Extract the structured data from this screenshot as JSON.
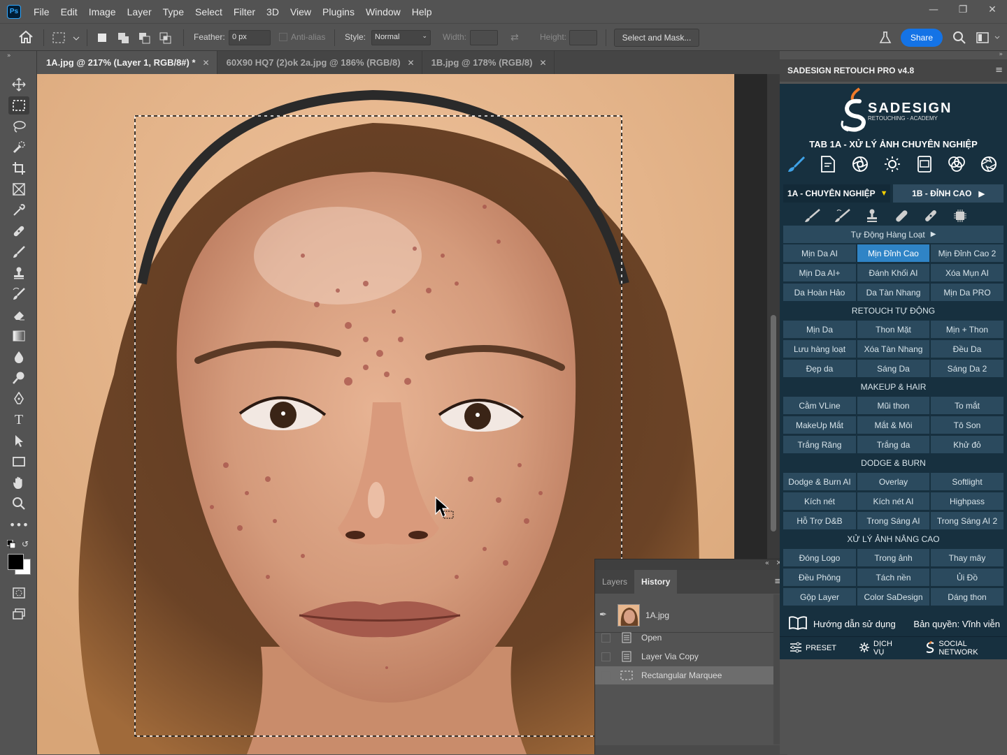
{
  "menu": [
    "File",
    "Edit",
    "Image",
    "Layer",
    "Type",
    "Select",
    "Filter",
    "3D",
    "View",
    "Plugins",
    "Window",
    "Help"
  ],
  "app_logo": "Ps",
  "options": {
    "feather_label": "Feather:",
    "feather_value": "0 px",
    "antialias_label": "Anti-alias",
    "style_label": "Style:",
    "style_value": "Normal",
    "width_label": "Width:",
    "height_label": "Height:",
    "select_mask_label": "Select and Mask...",
    "share_label": "Share"
  },
  "doc_tabs": [
    {
      "label": "1A.jpg @ 217% (Layer 1, RGB/8#) *",
      "active": true
    },
    {
      "label": "60X90 HQ7 (2)ok 2a.jpg @ 186% (RGB/8)",
      "active": false
    },
    {
      "label": "1B.jpg @ 178% (RGB/8)",
      "active": false
    }
  ],
  "history_panel": {
    "tabs": [
      "Layers",
      "History"
    ],
    "snapshot": "1A.jpg",
    "items": [
      {
        "label": "Open",
        "selected": false
      },
      {
        "label": "Layer Via Copy",
        "selected": false
      },
      {
        "label": "Rectangular Marquee",
        "selected": true
      }
    ]
  },
  "sadesign": {
    "panel_title": "SADESIGN RETOUCH PRO v4.8",
    "brand": "SADESIGN",
    "brand_sub": "RETOUCHING - ACADEMY",
    "tab_title": "TAB 1A - XỬ LÝ ẢNH CHUYÊN NGHIỆP",
    "subtab_1": "1A - CHUYÊN NGHIỆP",
    "subtab_2": "1B - ĐỈNH CAO",
    "auto_batch": "Tự Động Hàng Loạt",
    "rows_1": [
      [
        "Mịn Da AI",
        "Mịn Đỉnh Cao",
        "Mịn Đỉnh Cao 2"
      ],
      [
        "Mịn Da AI+",
        "Đánh Khối AI",
        "Xóa Mụn AI"
      ],
      [
        "Da Hoàn Hảo",
        "Da Tàn Nhang",
        "Mịn Da PRO"
      ]
    ],
    "section_retouch": "RETOUCH TỰ ĐỘNG",
    "rows_2": [
      [
        "Mịn Da",
        "Thon Mặt",
        "Mịn + Thon"
      ],
      [
        "Lưu hàng loạt",
        "Xóa Tàn Nhang",
        "Đều Da"
      ],
      [
        "Đẹp da",
        "Sáng Da",
        "Sáng Da 2"
      ]
    ],
    "section_makeup": "MAKEUP & HAIR",
    "rows_3": [
      [
        "Cằm VLine",
        "Mũi thon",
        "To mắt"
      ],
      [
        "MakeUp Mắt",
        "Mắt & Môi",
        "Tô Son"
      ],
      [
        "Trắng Răng",
        "Trắng da",
        "Khử đỏ"
      ]
    ],
    "section_dodge": "DODGE & BURN",
    "rows_4": [
      [
        "Dodge & Burn AI",
        "Overlay",
        "Softlight"
      ],
      [
        "Kích nét",
        "Kích nét AI",
        "Highpass"
      ],
      [
        "Hỗ Trợ D&B",
        "Trong Sáng AI",
        "Trong Sáng AI 2"
      ]
    ],
    "section_advanced": "XỬ LÝ ẢNH NÂNG CAO",
    "rows_5": [
      [
        "Đóng Logo",
        "Trong ảnh",
        "Thay mây"
      ],
      [
        "Đều Phông",
        "Tách nền",
        "Ủi Đồ"
      ],
      [
        "Gộp Layer",
        "Color SaDesign",
        "Dáng thon"
      ]
    ],
    "guide": "Hướng dẫn sử dụng",
    "license": "Bản quyền: Vĩnh viễn",
    "footer": [
      "PRESET",
      "DỊCH VỤ",
      "SOCIAL NETWORK"
    ],
    "highlight_color": "#2f84c6",
    "button_color": "#2b4a5e"
  }
}
